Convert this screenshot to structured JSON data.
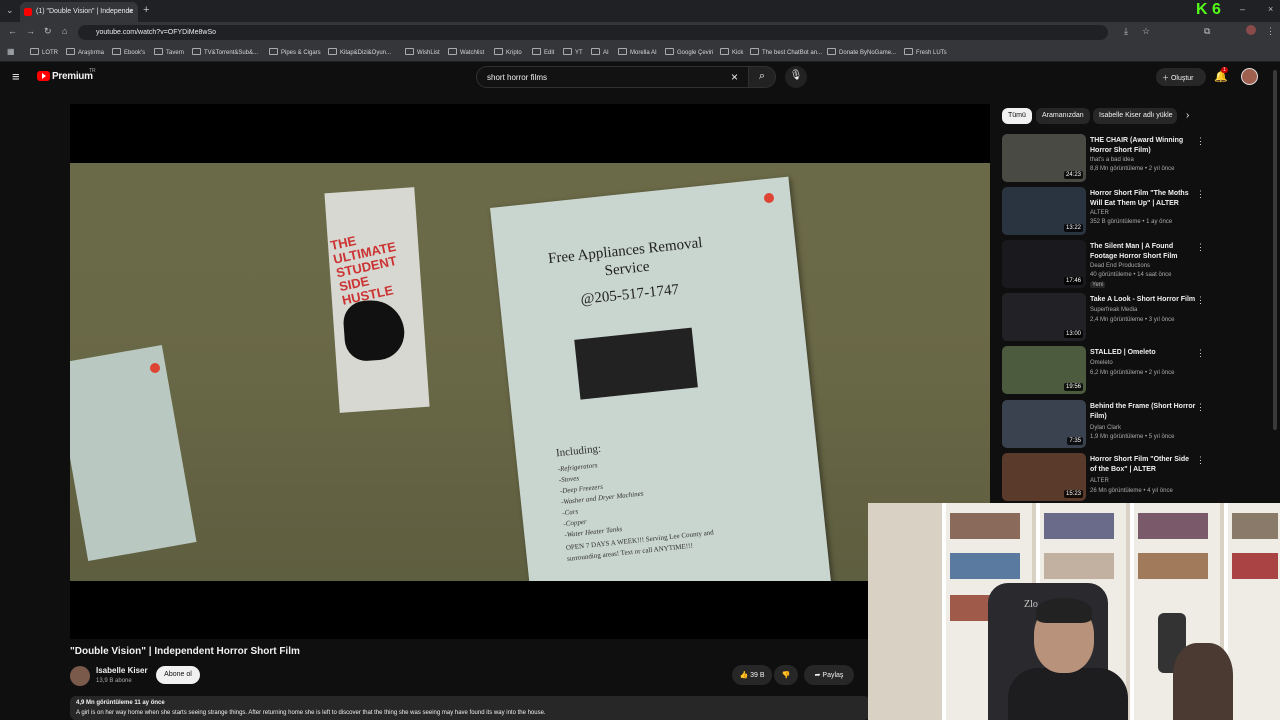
{
  "browser": {
    "tab_title": "(1) \"Double Vision\" | Independe",
    "url": "youtube.com/watch?v=OFYDiMe8wSo",
    "bookmarks": [
      "LOTR",
      "Araştırma",
      "Ebook's",
      "Tavern",
      "TV&Torrent&Sub&...",
      "Pipes & Cigars",
      "Kitap&Dizi&Oyun...",
      "WishList",
      "Watchlist",
      "Kripto",
      "Edit",
      "YT",
      "AI",
      "Morella AI",
      "Google Çeviri",
      "Kick",
      "The best ChatBot an...",
      "Donate ByNoGame...",
      "Fresh LUTs"
    ],
    "ext_badge": "K 6"
  },
  "youtube": {
    "logo_text": "Premium",
    "logo_sup": "TR",
    "search_value": "short horror films",
    "create_label": "Oluştur",
    "notif_count": "1"
  },
  "video": {
    "title": "\"Double Vision\" | Independent Horror Short Film",
    "channel": "Isabelle Kiser",
    "subscribers": "13,9 B abone",
    "subscribe_label": "Abone ol",
    "likes": "39 B",
    "share_label": "Paylaş",
    "views_date": "4,9 Mn görüntüleme  11 ay önce",
    "description": "A girl is on her way home when she starts seeing strange things. After returning home she is left to discover that the thing she was seeing may have found its way into the house.",
    "frame_text": {
      "flyer_title": "Free Appliances Removal Service",
      "flyer_phone": "@205-517-1747",
      "including": "Including:",
      "items": [
        "-Refrigerators",
        "-Stoves",
        "-Deep Freezers",
        "-Washer and Dryer Machines",
        "-Cars",
        "-Copper",
        "-Water Heater Tanks"
      ],
      "open": "OPEN 7 DAYS A WEEK!!! Serving Lee County and surrounding areas! Text or call ANYTIME!!!",
      "hustle": "THE ULTIMATE STUDENT SIDE HUSTLE"
    }
  },
  "sidebar": {
    "chips": [
      "Tümü",
      "Aramanızdan",
      "Isabelle Kiser adlı yükle"
    ],
    "recommendations": [
      {
        "title": "THE CHAIR (Award Winning Horror Short Film)",
        "channel": "that's a bad idea",
        "meta": "8,8 Mn görüntüleme • 2 yıl önce",
        "duration": "24:23",
        "color": "#4a4a44"
      },
      {
        "title": "Horror Short Film \"The Moths Will Eat Them Up\" | ALTER",
        "channel": "ALTER",
        "meta": "352 B görüntüleme • 1 ay önce",
        "duration": "13:22",
        "color": "#2a3440"
      },
      {
        "title": "The Silent Man | A Found Footage Horror Short Film",
        "channel": "Dead End Productions",
        "meta": "40 görüntüleme • 14 saat önce",
        "badge": "Yeni",
        "duration": "17:46",
        "color": "#1a1a1e"
      },
      {
        "title": "Take A Look - Short Horror Film",
        "channel": "Superfreak Media",
        "meta": "2,4 Mn görüntüleme • 3 yıl önce",
        "duration": "13:00",
        "color": "#222226"
      },
      {
        "title": "STALLED | Omeleto",
        "channel": "Omeleto",
        "meta": "6,2 Mn görüntüleme • 2 yıl önce",
        "duration": "19:56",
        "color": "#4c5a3e"
      },
      {
        "title": "Behind the Frame (Short Horror Film)",
        "channel": "Dylan Clark",
        "meta": "1,9 Mn görüntüleme • 5 yıl önce",
        "duration": "7:35",
        "color": "#3a4250"
      },
      {
        "title": "Horror Short Film \"Other Side of the Box\" | ALTER",
        "channel": "ALTER",
        "meta": "26 Mn görüntüleme • 4 yıl önce",
        "duration": "15:23",
        "color": "#5a3a2a"
      }
    ]
  },
  "webcam": {
    "chair_text": "Zlo"
  }
}
